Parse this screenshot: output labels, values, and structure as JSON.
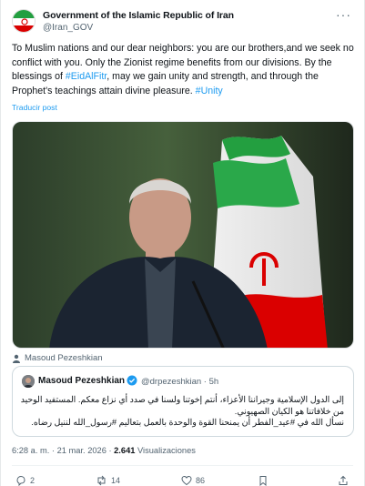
{
  "post": {
    "author": "Government of the Islamic Republic of Iran",
    "handle": "@Iran_GOV",
    "more": "···",
    "text_1": "To Muslim nations and our dear neighbors: you are our brothers,and we seek no conflict with you. Only the Zionist regime benefits from our divisions. By the blessings of ",
    "hashtag_1": "#EidAlFitr",
    "text_2": ", may we gain unity and strength, and through the Prophet's teachings attain divine pleasure. ",
    "hashtag_2": "#Unity",
    "translate_label": "Traducir post",
    "photo_credit": "Masoud Pezeshkian",
    "timestamp": "6:28 a. m. · 21 mar. 2026 · ",
    "views_count": "2.641",
    "views_label": " Visualizaciones"
  },
  "quote": {
    "name": "Masoud Pezeshkian",
    "meta": "@drpezeshkian · 5h",
    "text_line1": "إلى الدول الإسلامية وجيراننا الأعزاء، أنتم إخوتنا ولسنا في صدد أي نزاع معكم. المستفيد الوحيد من خلافاتنا هو الكيان الصهيوني.",
    "text_line2": "نسأل الله في #عيد_الفطر أن يمنحنا القوة والوحدة بالعمل بتعاليم #رسول_الله لننيل رضاه."
  },
  "actions": {
    "replies": "2",
    "reposts": "14",
    "likes": "86"
  },
  "colors": {
    "accent": "#1d9bf0",
    "muted": "#536471",
    "verified": "#1d9bf0",
    "flag_green": "#239f40",
    "flag_red": "#da0000"
  },
  "icons": [
    "more-icon",
    "verified-icon",
    "person-icon",
    "reply-icon",
    "repost-icon",
    "like-icon",
    "share-icon"
  ]
}
